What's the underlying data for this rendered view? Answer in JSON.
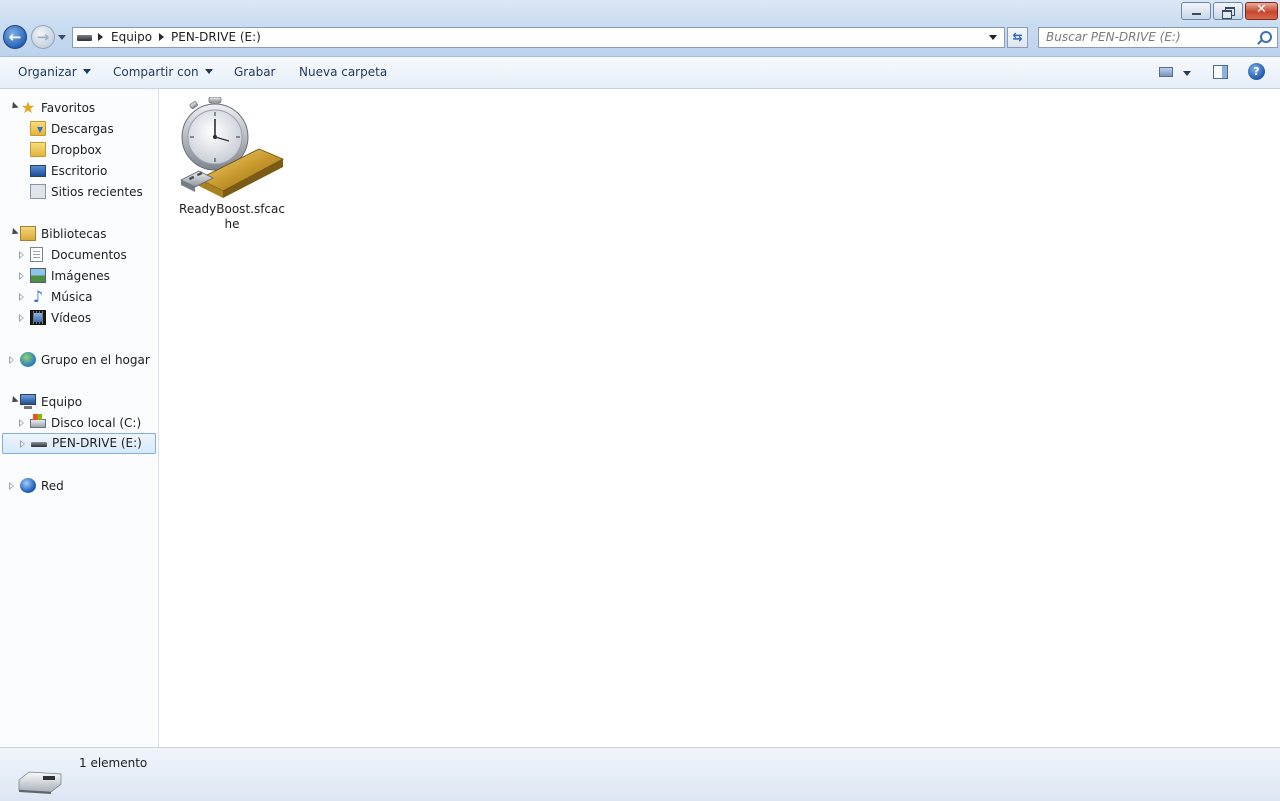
{
  "window": {
    "minimize_icon": "minimize-icon",
    "maximize_icon": "restore-icon",
    "close_glyph": "✕"
  },
  "navigation": {
    "back_glyph": "←",
    "forward_glyph": "→"
  },
  "address": {
    "breadcrumbs": [
      "Equipo",
      "PEN-DRIVE (E:)"
    ]
  },
  "search": {
    "placeholder": "Buscar PEN-DRIVE (E:)"
  },
  "toolbar": {
    "organizar": "Organizar",
    "compartir": "Compartir con",
    "grabar": "Grabar",
    "nueva_carpeta": "Nueva carpeta",
    "help_glyph": "?"
  },
  "sidebar": {
    "favoritos": {
      "label": "Favoritos",
      "items": [
        "Descargas",
        "Dropbox",
        "Escritorio",
        "Sitios recientes"
      ]
    },
    "bibliotecas": {
      "label": "Bibliotecas",
      "items": [
        "Documentos",
        "Imágenes",
        "Música",
        "Vídeos"
      ]
    },
    "grupo_hogar": "Grupo en el hogar",
    "equipo": {
      "label": "Equipo",
      "items": [
        "Disco local (C:)",
        "PEN-DRIVE (E:)"
      ]
    },
    "red": "Red"
  },
  "content": {
    "files": [
      {
        "name": "ReadyBoost.sfcache",
        "icon": "readyboost-usb-stopwatch-icon"
      }
    ]
  },
  "details": {
    "count": "1 elemento"
  },
  "colors": {
    "selection_border": "#84acdd",
    "accent_blue": "#2a63b8"
  }
}
